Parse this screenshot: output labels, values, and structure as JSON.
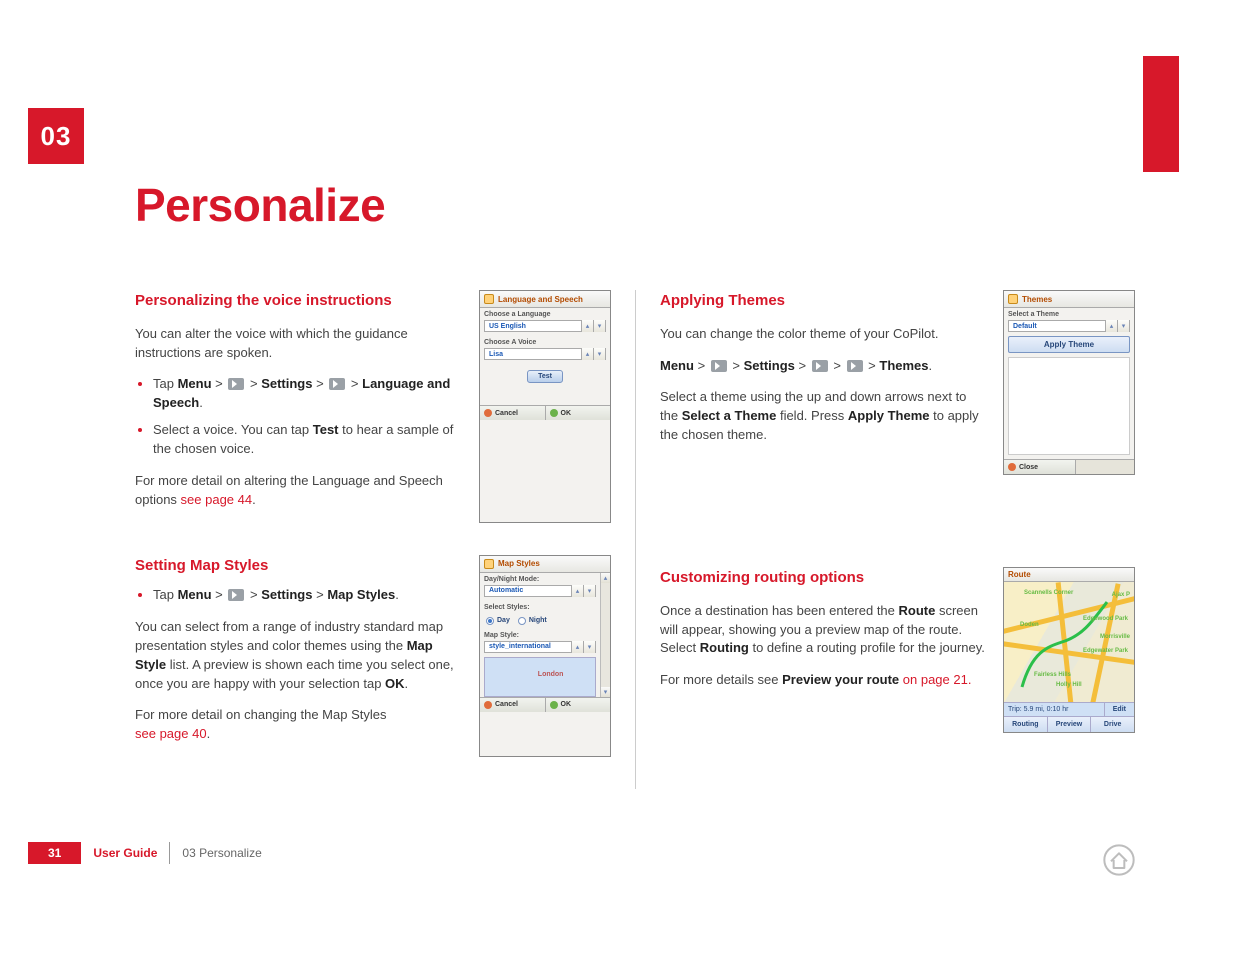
{
  "chapter": {
    "number": "03",
    "title": "Personalize"
  },
  "footer": {
    "page": "31",
    "guide": "User Guide",
    "crumb": "03 Personalize"
  },
  "voice": {
    "heading": "Personalizing the voice instructions",
    "intro": "You can alter the voice with which the guidance instructions are spoken.",
    "b1_pre": "Tap ",
    "b1_menu": "Menu",
    "b1_settings": "Settings",
    "b1_lang": "Language and Speech",
    "b2_pre": "Select a voice. You can tap ",
    "b2_test": "Test",
    "b2_post": " to hear a sample of the chosen voice.",
    "more": "For more detail on altering the Language and Speech options ",
    "more_link": "see page 44",
    "mock": {
      "title": "Language and Speech",
      "label1": "Choose a Language",
      "val1": "US English",
      "label2": "Choose A Voice",
      "val2": "Lisa",
      "test": "Test",
      "cancel": "Cancel",
      "ok": "OK"
    }
  },
  "mapstyles": {
    "heading": "Setting Map Styles",
    "b1_pre": "Tap ",
    "b1_menu": "Menu",
    "b1_settings": "Settings",
    "b1_target": "Map Styles",
    "p1a": "You can select from a range of industry standard map presentation styles and color themes using the ",
    "p1b": "Map Style",
    "p1c": " list. A preview is shown each time you select one, once you are happy with your selection tap ",
    "p1d": "OK",
    "more": "For more detail on changing the Map Styles ",
    "more_link": "see page 40",
    "mock": {
      "title": "Map Styles",
      "label1": "Day/Night Mode:",
      "val1": "Automatic",
      "label2": "Select Styles:",
      "radio_day": "Day",
      "radio_night": "Night",
      "label3": "Map Style:",
      "val3": "style_international",
      "cancel": "Cancel",
      "ok": "OK"
    }
  },
  "themes": {
    "heading": "Applying Themes",
    "p1": "You can change the color theme of your CoPilot.",
    "nav_menu": "Menu",
    "nav_settings": "Settings",
    "nav_themes": "Themes",
    "p2a": "Select a theme using the up and down arrows next to the ",
    "p2b": "Select a Theme",
    "p2c": " field. Press ",
    "p2d": "Apply Theme",
    "p2e": " to apply the chosen theme.",
    "mock": {
      "title": "Themes",
      "label1": "Select a Theme",
      "val1": "Default",
      "apply": "Apply Theme",
      "close": "Close"
    }
  },
  "routing": {
    "heading": "Customizing routing options",
    "p1a": "Once a destination has been entered the ",
    "p1b": "Route",
    "p1c": " screen will appear, showing you a preview map of the route. Select ",
    "p1d": "Routing",
    "p1e": " to define a routing profile for the journey.",
    "more": "For more details see ",
    "more_link": "Preview your route",
    "more_tail": " on page 21.",
    "mock": {
      "title": "Route",
      "places": {
        "p1": "Scannells Corner",
        "p2": "Ajax P",
        "p3": "Doden",
        "p4": "Edgewood Park",
        "p5": "Morrisville",
        "p6": "Edgewater Park",
        "p7": "Fairless Hills",
        "p8": "Holly Hill"
      },
      "trip": "Trip:  5.9 mi, 0:10 hr",
      "edit": "Edit",
      "btn1": "Routing",
      "btn2": "Preview",
      "btn3": "Drive"
    }
  }
}
